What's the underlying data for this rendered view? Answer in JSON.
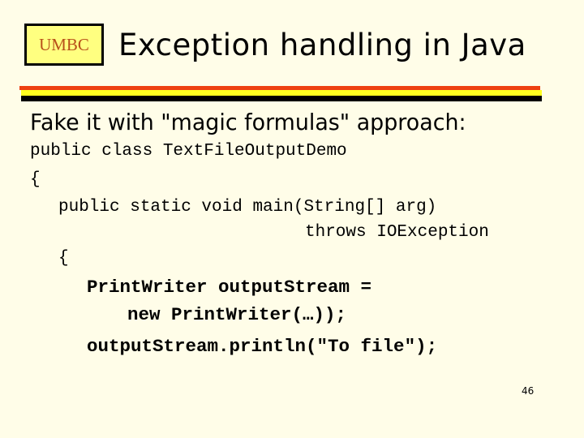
{
  "header": {
    "logo_text": "UMBC",
    "title": "Exception handling in Java"
  },
  "colors": {
    "background": "#fffde8",
    "logo_fill": "#ffff80",
    "logo_text": "#b8501a",
    "stripe_red": "#ee4010",
    "stripe_yellow": "#ffff20",
    "stripe_black": "#000000"
  },
  "body": {
    "subtitle": "Fake it with \"magic formulas\" approach:",
    "code_lines": [
      "public class TextFileOutputDemo",
      "{",
      "public static void main(String[] arg)",
      "throws IOException",
      "{",
      "PrintWriter outputStream =",
      "new PrintWriter(…));",
      "outputStream.println(\"To file\");"
    ]
  },
  "footer": {
    "page_number": "46"
  }
}
